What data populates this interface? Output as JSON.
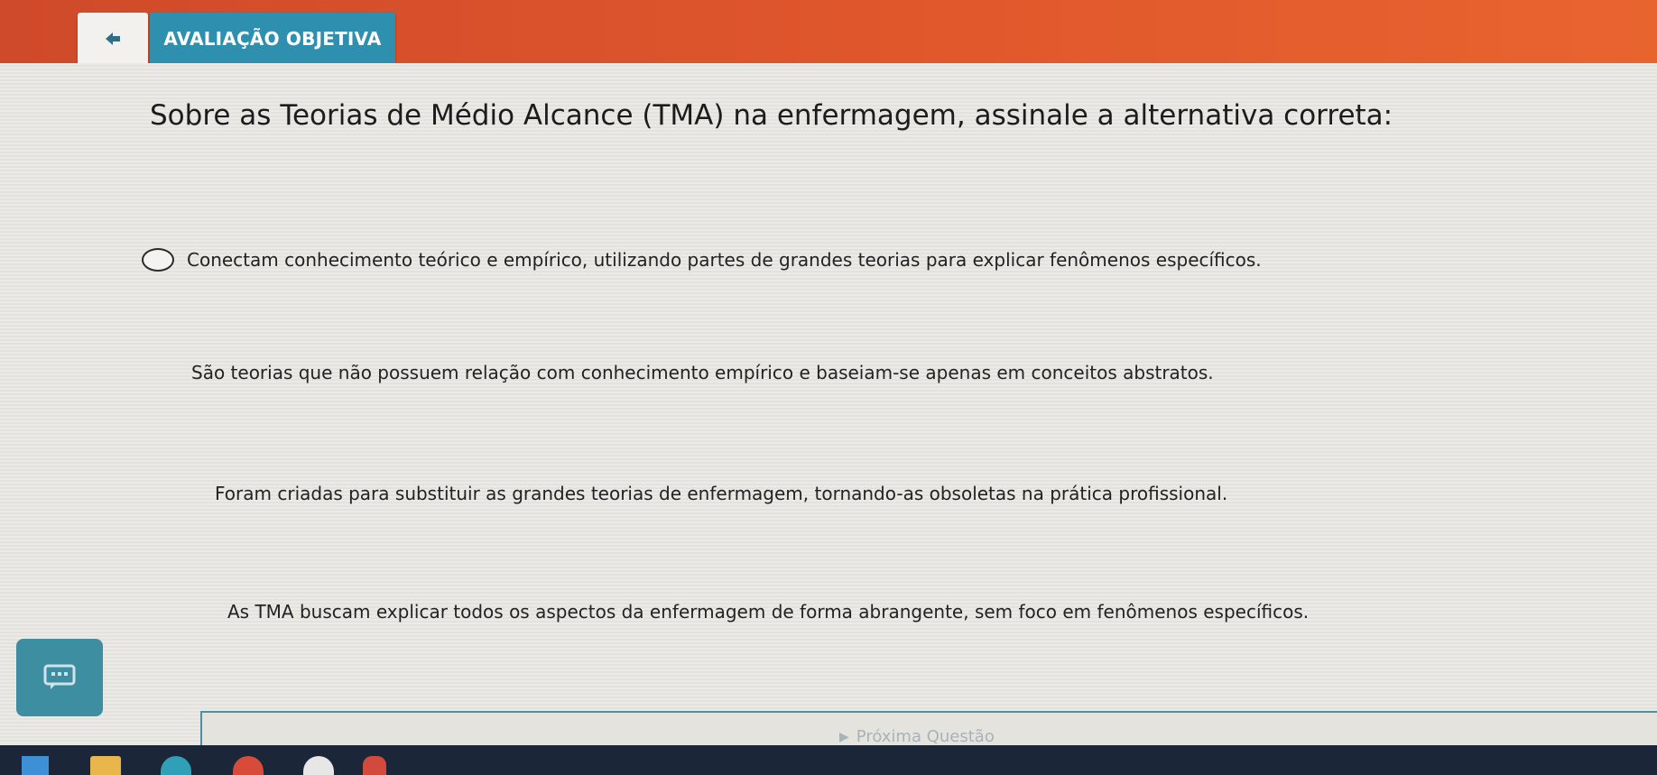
{
  "header": {
    "back_icon": "back-arrow-icon",
    "title": "AVALIAÇÃO OBJETIVA",
    "color_start": "#cf4a2a",
    "color_end": "#e8642f",
    "tab_color": "#2f8fae"
  },
  "question": {
    "text": "Sobre as Teorias de Médio Alcance (TMA) na enfermagem, assinale a alternativa correta:"
  },
  "options": [
    {
      "text": "Conectam conhecimento teórico e empírico, utilizando partes de grandes teorias para explicar fenômenos específicos."
    },
    {
      "text": "São teorias que não possuem relação com conhecimento empírico e baseiam-se apenas em conceitos abstratos."
    },
    {
      "text": "Foram criadas para substituir as grandes teorias de enfermagem, tornando-as obsoletas na prática profissional."
    },
    {
      "text": "As TMA buscam explicar todos os aspectos da enfermagem de forma abrangente, sem foco em fenômenos específicos."
    }
  ],
  "footer": {
    "next_label": "Próxima Questão",
    "next_icon": "play-icon",
    "chat_icon": "chat-icon"
  },
  "taskbar": {
    "icons": [
      "windows-icon",
      "folder-icon",
      "edge-icon",
      "chrome-icon",
      "app-icon",
      "app-icon-2"
    ]
  }
}
